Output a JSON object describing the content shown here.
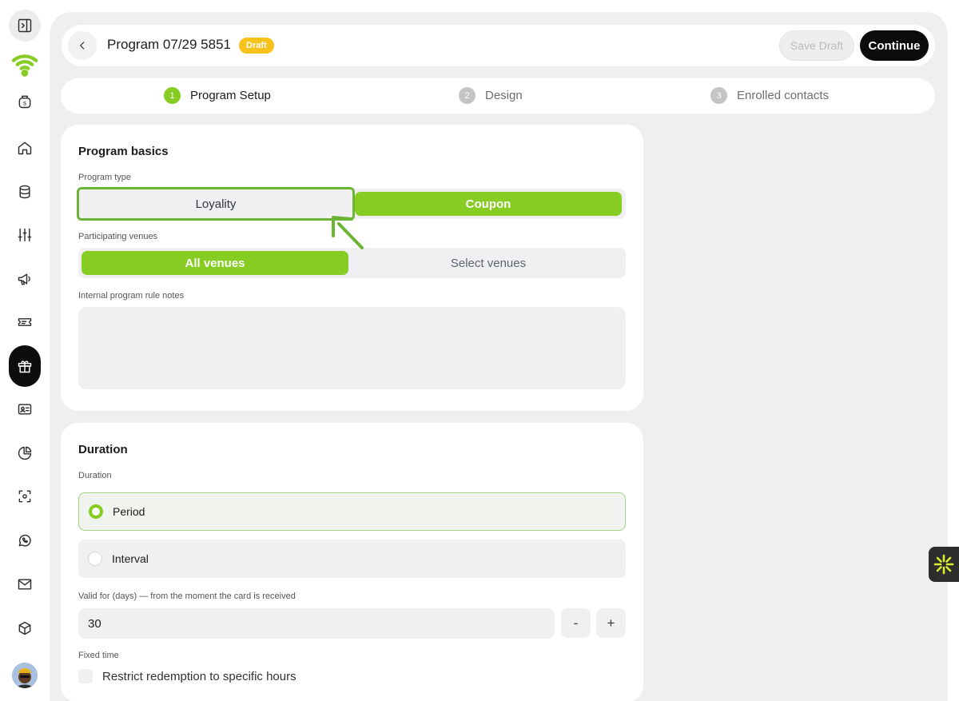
{
  "header": {
    "title": "Program 07/29 5851",
    "status_badge": "Draft",
    "save_draft_label": "Save Draft",
    "continue_label": "Continue"
  },
  "stepper": {
    "steps": [
      {
        "num": "1",
        "label": "Program Setup",
        "active": true
      },
      {
        "num": "2",
        "label": "Design",
        "active": false
      },
      {
        "num": "3",
        "label": "Enrolled contacts",
        "active": false
      }
    ]
  },
  "program_basics": {
    "title": "Program basics",
    "program_type_label": "Program type",
    "program_type_options": [
      "Loyality",
      "Coupon"
    ],
    "program_type_selected": "Coupon",
    "venues_label": "Participating venues",
    "venues_options": [
      "All venues",
      "Select venues"
    ],
    "venues_selected": "All venues",
    "notes_label": "Internal program rule notes",
    "notes_value": ""
  },
  "duration": {
    "title": "Duration",
    "duration_label": "Duration",
    "options": [
      "Period",
      "Interval"
    ],
    "selected": "Period",
    "valid_for_label": "Valid for (days) — from the moment the card is received",
    "valid_for_value": "30",
    "decrement_label": "-",
    "increment_label": "+",
    "fixed_time_label": "Fixed time",
    "restrict_label": "Restrict redemption to specific hours",
    "restrict_checked": false
  },
  "sidebar": {
    "items": [
      "panel-toggle-icon",
      "wifi-logo-icon",
      "money-bag-icon",
      "home-icon",
      "database-icon",
      "sliders-icon",
      "megaphone-icon",
      "ticket-icon",
      "gift-icon",
      "contact-card-icon",
      "pie-chart-icon",
      "scan-icon",
      "whatsapp-icon",
      "mail-icon",
      "box-icon"
    ],
    "active_item": "gift-icon"
  },
  "colors": {
    "accent": "#86cc22",
    "badge": "#f7c21a",
    "annotation": "#6bb434"
  }
}
